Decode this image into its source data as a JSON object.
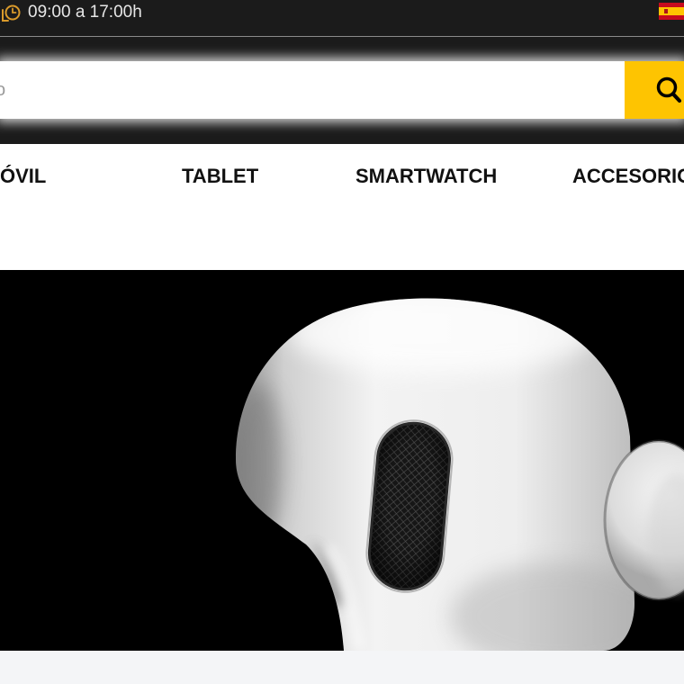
{
  "topbar": {
    "hours": "09:00 a 17:00h"
  },
  "search": {
    "placeholder": "o"
  },
  "nav": {
    "items": [
      {
        "label": "ÓVIL"
      },
      {
        "label": "TABLET"
      },
      {
        "label": "SMARTWATCH"
      },
      {
        "label": "ACCESORIO"
      }
    ]
  },
  "icons": {
    "clock": "clock-icon",
    "language_flag": "flag-es-icon",
    "search": "search-icon"
  },
  "colors": {
    "topbar_bg": "#1b1b1b",
    "accent": "#fec401",
    "icon_gold": "#d99a2b",
    "nav_text": "#111111",
    "hero_bg": "#000000",
    "strip_bg": "#f4f5f7",
    "hours_text": "#e6e6e6"
  }
}
